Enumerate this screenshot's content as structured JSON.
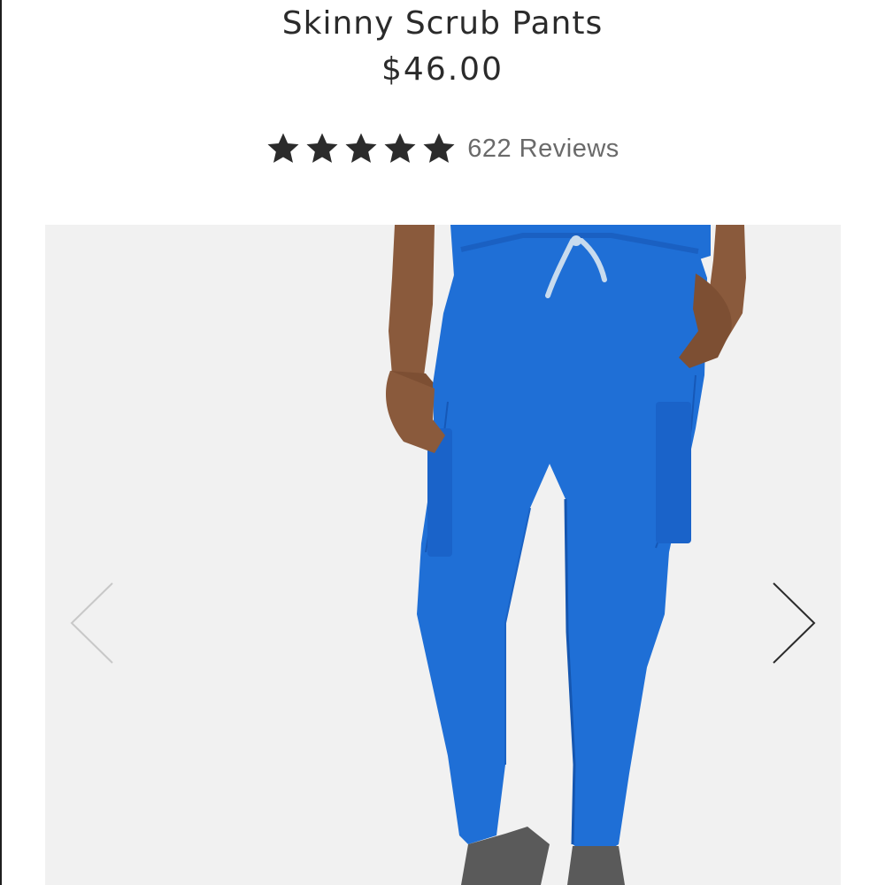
{
  "product": {
    "title": "Skinny Scrub Pants",
    "price": "$46.00",
    "rating": 5,
    "rating_max": 5,
    "reviews_label": "622 Reviews"
  },
  "gallery": {
    "background": "#f1f1f1",
    "pants_color": "#1f6fd6",
    "prev_icon": "chevron-left-icon",
    "next_icon": "chevron-right-icon"
  },
  "colors": {
    "text": "#2b2b2b",
    "reviews_text": "#6a6a6a",
    "star": "#2b2b2b"
  }
}
